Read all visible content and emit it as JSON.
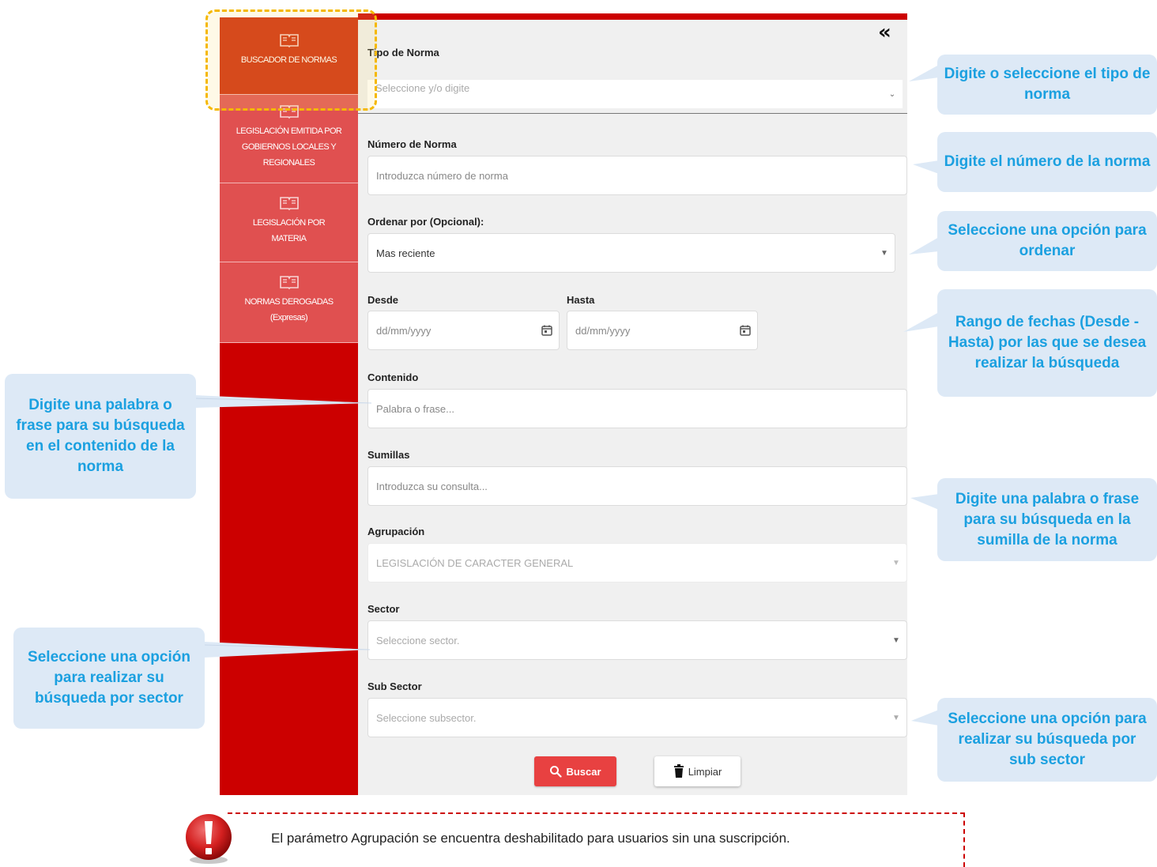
{
  "sidebar": {
    "items": [
      {
        "label": "BUSCADOR DE NORMAS",
        "icon": "book-icon"
      },
      {
        "label": "LEGISLACIÓN EMITIDA POR GOBIERNOS LOCALES Y REGIONALES",
        "icon": "book-icon"
      },
      {
        "label": "LEGISLACIÓN POR MATERIA",
        "icon": "book-icon"
      },
      {
        "label": "NORMAS DEROGADAS (Expresas)",
        "icon": "book-icon"
      }
    ]
  },
  "form": {
    "collapse_icon": "«",
    "tipo_norma": {
      "label": "Tipo de Norma",
      "placeholder": "Seleccione y/o digite"
    },
    "numero_norma": {
      "label": "Número de Norma",
      "placeholder": "Introduzca número de norma"
    },
    "ordenar": {
      "label": "Ordenar por (Opcional):",
      "value": "Mas reciente"
    },
    "desde": {
      "label": "Desde",
      "placeholder": "dd/mm/yyyy"
    },
    "hasta": {
      "label": "Hasta",
      "placeholder": "dd/mm/yyyy"
    },
    "contenido": {
      "label": "Contenido",
      "placeholder": "Palabra o frase..."
    },
    "sumillas": {
      "label": "Sumillas",
      "placeholder": "Introduzca su consulta..."
    },
    "agrupacion": {
      "label": "Agrupación",
      "value": "LEGISLACIÓN DE CARACTER GENERAL"
    },
    "sector": {
      "label": "Sector",
      "placeholder": "Seleccione sector."
    },
    "subsector": {
      "label": "Sub Sector",
      "placeholder": "Seleccione subsector."
    },
    "buscar_label": "Buscar",
    "limpiar_label": "Limpiar"
  },
  "callouts": {
    "tipo": "Digite o seleccione el tipo de norma",
    "numero": "Digite el número de la norma",
    "ordenar": "Seleccione una opción para ordenar",
    "fechas": "Rango de fechas (Desde - Hasta) por las que se desea realizar la búsqueda",
    "contenido": "Digite una palabra o frase para su búsqueda en el contenido de la norma",
    "sumilla": "Digite una palabra o frase para su búsqueda en la sumilla de la norma",
    "sector": "Seleccione una opción para realizar su búsqueda por sector",
    "subsector": "Seleccione una opción para realizar su búsqueda por sub sector"
  },
  "note": {
    "text": "El parámetro Agrupación se encuentra deshabilitado para usuarios sin una suscripción."
  },
  "colors": {
    "sidebar_red": "#cc0000",
    "active_item": "#cf2a08",
    "inactive_item": "#e05050",
    "callout_bg": "#dde9f6",
    "callout_text": "#1ba0e0",
    "highlight": "#f5b800",
    "buscar_button": "#e84141"
  }
}
